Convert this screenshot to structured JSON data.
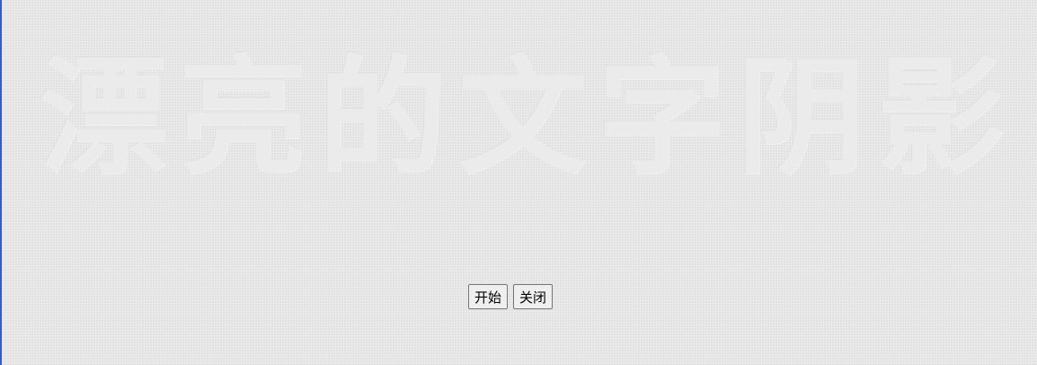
{
  "headline": {
    "chars": [
      "漂",
      "亮",
      "的",
      "文",
      "字",
      "阴",
      "影"
    ]
  },
  "controls": {
    "start_label": "开始",
    "close_label": "关闭"
  }
}
